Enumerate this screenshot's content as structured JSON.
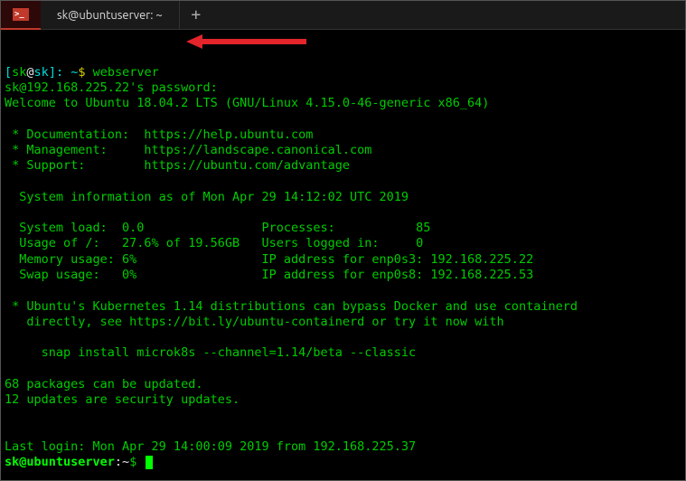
{
  "tabbar": {
    "icon_glyph": ">_",
    "tab_title": "sk@ubuntuserver: ~",
    "add_glyph": "+"
  },
  "first_prompt": {
    "open": "[",
    "user": "sk",
    "at": "@",
    "host": "sk",
    "close_path": "]: ~",
    "dollar": "$ ",
    "command": "webserver"
  },
  "lines": {
    "pw": "sk@192.168.225.22's password:",
    "welcome": "Welcome to Ubuntu 18.04.2 LTS (GNU/Linux 4.15.0-46-generic x86_64)",
    "doc": " * Documentation:  https://help.ubuntu.com",
    "mgmt": " * Management:     https://landscape.canonical.com",
    "support": " * Support:        https://ubuntu.com/advantage",
    "sysinfo": "  System information as of Mon Apr 29 14:12:02 UTC 2019",
    "row1": "  System load:  0.0                Processes:           85",
    "row2": "  Usage of /:   27.6% of 19.56GB   Users logged in:     0",
    "row3": "  Memory usage: 6%                 IP address for enp0s3: 192.168.225.22",
    "row4": "  Swap usage:   0%                 IP address for enp0s8: 192.168.225.53",
    "k8s1": " * Ubuntu's Kubernetes 1.14 distributions can bypass Docker and use containerd",
    "k8s2": "   directly, see https://bit.ly/ubuntu-containerd or try it now with",
    "snap": "     snap install microk8s --channel=1.14/beta --classic",
    "pkg1": "68 packages can be updated.",
    "pkg2": "12 updates are security updates.",
    "last": "Last login: Mon Apr 29 14:00:09 2019 from 192.168.225.37"
  },
  "second_prompt": {
    "user_host": "sk@ubuntuserver",
    "path": ":~",
    "dollar": "$ "
  }
}
